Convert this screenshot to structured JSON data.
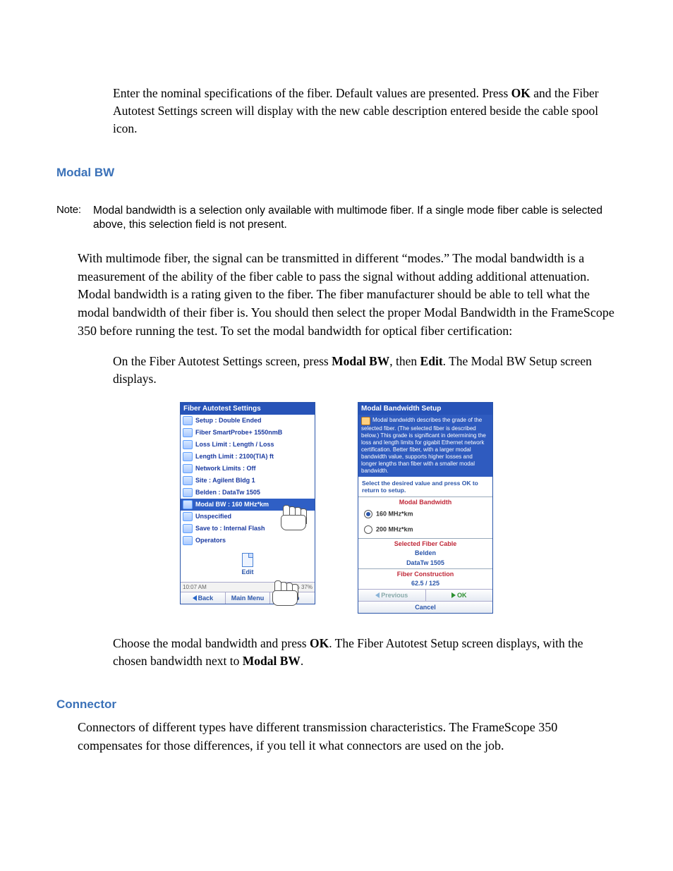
{
  "step3": "Enter the nominal specifications of the fiber. Default values are presented. Press ",
  "step3b": " and the Fiber Autotest Settings screen will display with the new cable description entered beside the cable spool icon.",
  "ok": "OK",
  "modal_heading": "Modal BW",
  "note_label": "Note:",
  "note_text": "Modal bandwidth is a selection only available with multimode fiber. If a single mode fiber cable is selected above, this selection field is not present.",
  "modal_para": "With multimode fiber, the signal can be transmitted in different “modes.” The modal bandwidth is a measurement of the ability of the fiber cable to pass the signal without adding additional attenuation. Modal bandwidth is a rating given to the fiber. The fiber manufacturer should be able to tell what the modal bandwidth of their fiber is. You should then select the proper Modal Bandwidth in the FrameScope 350 before running the test. To set the modal bandwidth for optical fiber certification:",
  "step1": "On the Fiber Autotest Settings screen, press ",
  "step1b": ", then ",
  "step1c": ". The Modal BW Setup screen displays.",
  "modalbw": "Modal BW",
  "edit": "Edit",
  "step2": "Choose the modal bandwidth and press ",
  "step2b": ". The Fiber Autotest Setup screen displays, with the chosen bandwidth next to ",
  "step2c": ".",
  "conn_heading": "Connector",
  "conn_para": "Connectors of different types have different transmission characteristics. The FrameScope 350 compensates for those differences, if you tell it what connectors are used on the job.",
  "dev_left": {
    "title": "Fiber Autotest Settings",
    "rows": [
      "Setup : Double Ended",
      "Fiber SmartProbe+ 1550nmB",
      "Loss Limit : Length / Loss",
      "Length Limit : 2100(TIA) ft",
      "Network Limits : Off",
      "Site : Agilent Bldg 1",
      "Belden : DataTw 1505",
      "Modal BW : 160 MHz*km",
      "Unspecified",
      "Save to : Internal Flash",
      "Operators"
    ],
    "edit": "Edit",
    "time": "10:07 AM",
    "bat": "49% 37%",
    "btns": [
      "Back",
      "Main Menu",
      "Help"
    ]
  },
  "dev_right": {
    "title": "Modal Bandwidth Setup",
    "info": "Modal bandwidth describes the grade of the selected fiber. (The selected fiber is described below.) This grade is significant in determining the loss and length limits for gigabit Ethernet network certification. Better fiber, with a larger modal bandwidth value, supports higher losses and longer lengths than fiber with a smaller modal bandwidth.",
    "select": "Select the desired value and press OK to return to setup.",
    "sect1": "Modal Bandwidth",
    "opt1": "160 MHz*km",
    "opt2": "200 MHz*km",
    "sect2": "Selected Fiber Cable",
    "mfr": "Belden",
    "model": "DataTw 1505",
    "sect3": "Fiber Construction",
    "size": "62.5 / 125",
    "prev": "Previous",
    "ok": "OK",
    "cancel": "Cancel"
  }
}
